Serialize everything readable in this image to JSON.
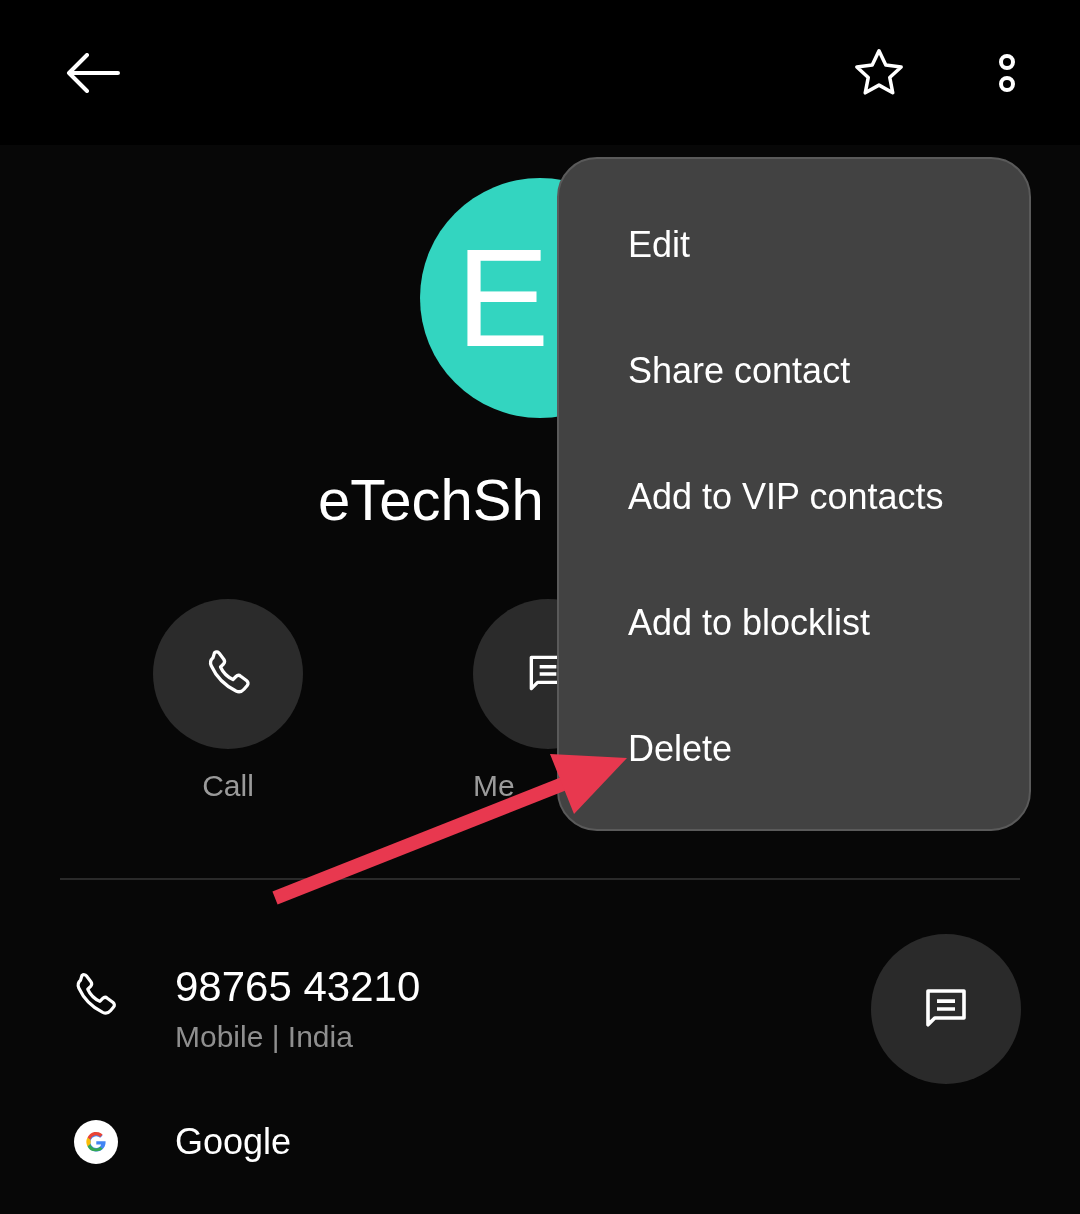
{
  "avatar": {
    "letter": "E",
    "color": "#33d5c0"
  },
  "contact_name": "eTechSh",
  "actions": [
    {
      "label": "Call",
      "kind": "call"
    },
    {
      "label": "Me",
      "kind": "message"
    }
  ],
  "phone": {
    "number": "98765 43210",
    "type": "Mobile | India"
  },
  "account": {
    "name": "Google"
  },
  "menu": {
    "items": [
      "Edit",
      "Share contact",
      "Add to VIP contacts",
      "Add to blocklist",
      "Delete"
    ]
  }
}
